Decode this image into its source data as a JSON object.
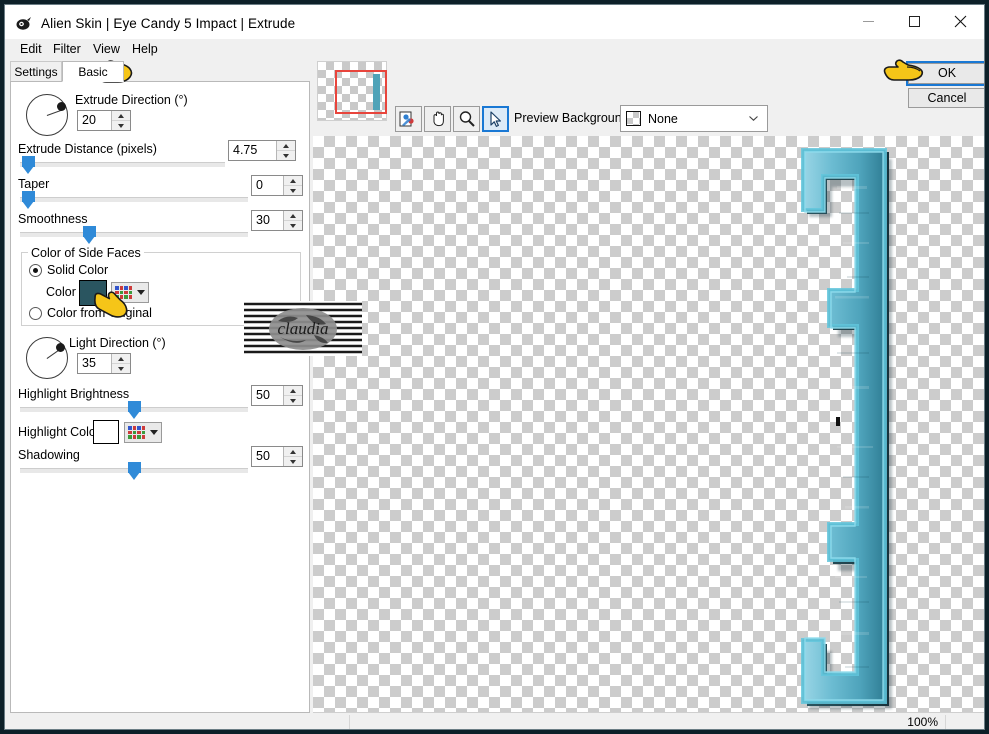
{
  "window": {
    "title": "Alien Skin | Eye Candy 5 Impact | Extrude",
    "icon": "app-icon",
    "minimize": "—",
    "maximize": "□",
    "close": "✕"
  },
  "menu": {
    "items": [
      {
        "label": "Edit"
      },
      {
        "label": "Filter"
      },
      {
        "label": "View"
      },
      {
        "label": "Help"
      }
    ]
  },
  "tabs": [
    {
      "label": "Settings",
      "active": false
    },
    {
      "label": "Basic",
      "active": true
    }
  ],
  "controls": {
    "extrude_direction": {
      "label": "Extrude Direction (°)",
      "value": "20",
      "dial_angle_deg": 20
    },
    "extrude_distance": {
      "label": "Extrude Distance (pixels)",
      "value": "4.75",
      "slider_pct": 4
    },
    "taper": {
      "label": "Taper",
      "value": "0",
      "slider_pct": 2
    },
    "smoothness": {
      "label": "Smoothness",
      "value": "30",
      "slider_pct": 30
    },
    "side_faces_group": {
      "title": "Color of Side Faces",
      "solid_color": {
        "label": "Solid Color",
        "selected": true
      },
      "color": {
        "label": "Color",
        "value": "#2a5560"
      },
      "color_from_original": {
        "label": "Color from Original",
        "selected": false
      }
    },
    "light_direction": {
      "label": "Light Direction (°)",
      "value": "35",
      "dial_angle_deg": 35
    },
    "highlight_brightness": {
      "label": "Highlight Brightness",
      "value": "50",
      "slider_pct": 50
    },
    "highlight_color": {
      "label": "Highlight Color",
      "value": "#ffffff"
    },
    "shadowing": {
      "label": "Shadowing",
      "value": "50",
      "slider_pct": 50
    }
  },
  "toolbar": {
    "tools": [
      {
        "name": "color-picker-icon",
        "selected": false
      },
      {
        "name": "hand-pan-icon",
        "selected": false
      },
      {
        "name": "zoom-magnifier-icon",
        "selected": false
      },
      {
        "name": "arrow-select-icon",
        "selected": true
      }
    ],
    "preview_background_label": "Preview Background:",
    "preview_background_value": "None"
  },
  "buttons": {
    "ok": "OK",
    "cancel": "Cancel"
  },
  "status": {
    "zoom": "100%"
  },
  "watermark": {
    "text": "claudia"
  },
  "colors": {
    "accent": "#1978d4",
    "slider": "#2f8ad8",
    "side_face": "#2a5560",
    "shape_light": "#7fcede",
    "shape_mid": "#49a7bd",
    "shape_dark": "#2b6d80",
    "selection_rect": "#e8453c"
  }
}
